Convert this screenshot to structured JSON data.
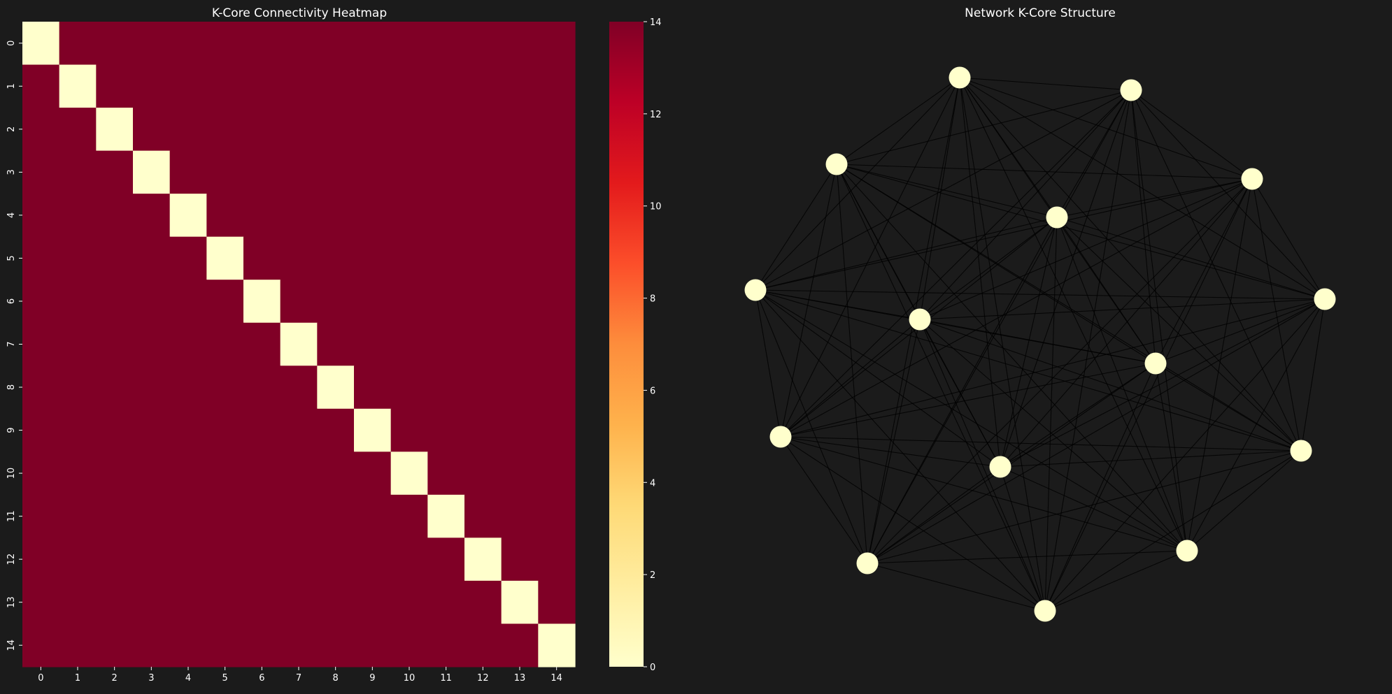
{
  "colors": {
    "background": "#1b1b1b",
    "text": "#ffffff",
    "edge": "#000000",
    "node": "#ffffcc"
  },
  "colormap": {
    "name": "YlOrRd",
    "stops": [
      "#ffffcc",
      "#ffeda0",
      "#fed976",
      "#feb24c",
      "#fd8d3c",
      "#fc4e2a",
      "#e31a1c",
      "#bd0026",
      "#800026"
    ]
  },
  "chart_data": [
    {
      "type": "heatmap",
      "title": "K-Core Connectivity Heatmap",
      "x_tick_labels": [
        "0",
        "1",
        "2",
        "3",
        "4",
        "5",
        "6",
        "7",
        "8",
        "9",
        "10",
        "11",
        "12",
        "13",
        "14"
      ],
      "y_tick_labels": [
        "0",
        "1",
        "2",
        "3",
        "4",
        "5",
        "6",
        "7",
        "8",
        "9",
        "10",
        "11",
        "12",
        "13",
        "14"
      ],
      "matrix_description": "15x15 matrix: 0 on the diagonal, 14 elsewhere",
      "size": 15,
      "diagonal_value": 0,
      "off_diagonal_value": 14,
      "colorbar": {
        "min": 0,
        "max": 14,
        "ticks": [
          "0",
          "2",
          "4",
          "6",
          "8",
          "10",
          "12",
          "14"
        ]
      }
    },
    {
      "type": "network",
      "title": "Network K-Core Structure",
      "node_count": 15,
      "complete_graph": true
    }
  ]
}
